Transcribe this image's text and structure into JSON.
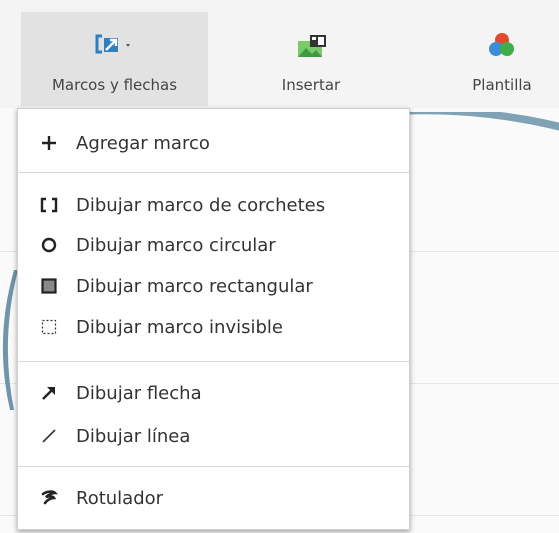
{
  "toolbar": {
    "frames_label": "Marcos y flechas",
    "insert_label": "Insertar",
    "template_label": "Plantilla"
  },
  "menu": {
    "add_frame": "Agregar marco",
    "bracket_frame": "Dibujar marco de corchetes",
    "circle_frame": "Dibujar marco circular",
    "rect_frame": "Dibujar marco rectangular",
    "invisible_frame": "Dibujar marco invisible",
    "arrow": "Dibujar flecha",
    "line": "Dibujar línea",
    "marker": "Rotulador"
  },
  "colors": {
    "accent_blue": "#2f7fc1",
    "canvas_shape": "#7fa2b6"
  }
}
